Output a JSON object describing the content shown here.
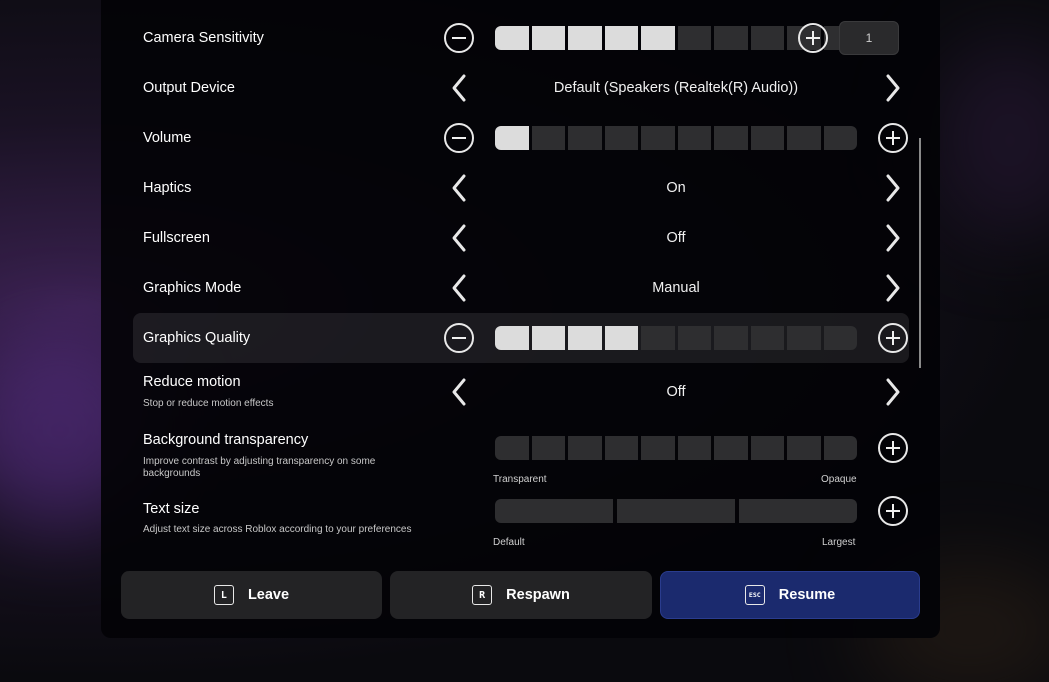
{
  "settings": {
    "camera_sensitivity": {
      "label": "Camera Sensitivity",
      "level": 5,
      "total": 10,
      "value": "1"
    },
    "output_device": {
      "label": "Output Device",
      "value": "Default (Speakers (Realtek(R) Audio))"
    },
    "volume": {
      "label": "Volume",
      "level": 1,
      "total": 10
    },
    "haptics": {
      "label": "Haptics",
      "value": "On"
    },
    "fullscreen": {
      "label": "Fullscreen",
      "value": "Off"
    },
    "graphics_mode": {
      "label": "Graphics Mode",
      "value": "Manual"
    },
    "graphics_quality": {
      "label": "Graphics Quality",
      "level": 4,
      "total": 10
    },
    "reduce_motion": {
      "label": "Reduce motion",
      "description": "Stop or reduce motion effects",
      "value": "Off"
    },
    "background_transparency": {
      "label": "Background transparency",
      "description": "Improve contrast by adjusting transparency on some backgrounds",
      "level": 0,
      "total": 10,
      "min_label": "Transparent",
      "max_label": "Opaque"
    },
    "text_size": {
      "label": "Text size",
      "description": "Adjust text size across Roblox according to your preferences",
      "level": 0,
      "total": 3,
      "min_label": "Default",
      "max_label": "Largest"
    }
  },
  "actions": {
    "leave": {
      "label": "Leave",
      "key": "L"
    },
    "respawn": {
      "label": "Respawn",
      "key": "R"
    },
    "resume": {
      "label": "Resume",
      "key": "ESC"
    }
  },
  "colors": {
    "accent": "#1b2a6e",
    "segment_on": "#dcdcdc",
    "segment_off": "#2e2e30"
  }
}
